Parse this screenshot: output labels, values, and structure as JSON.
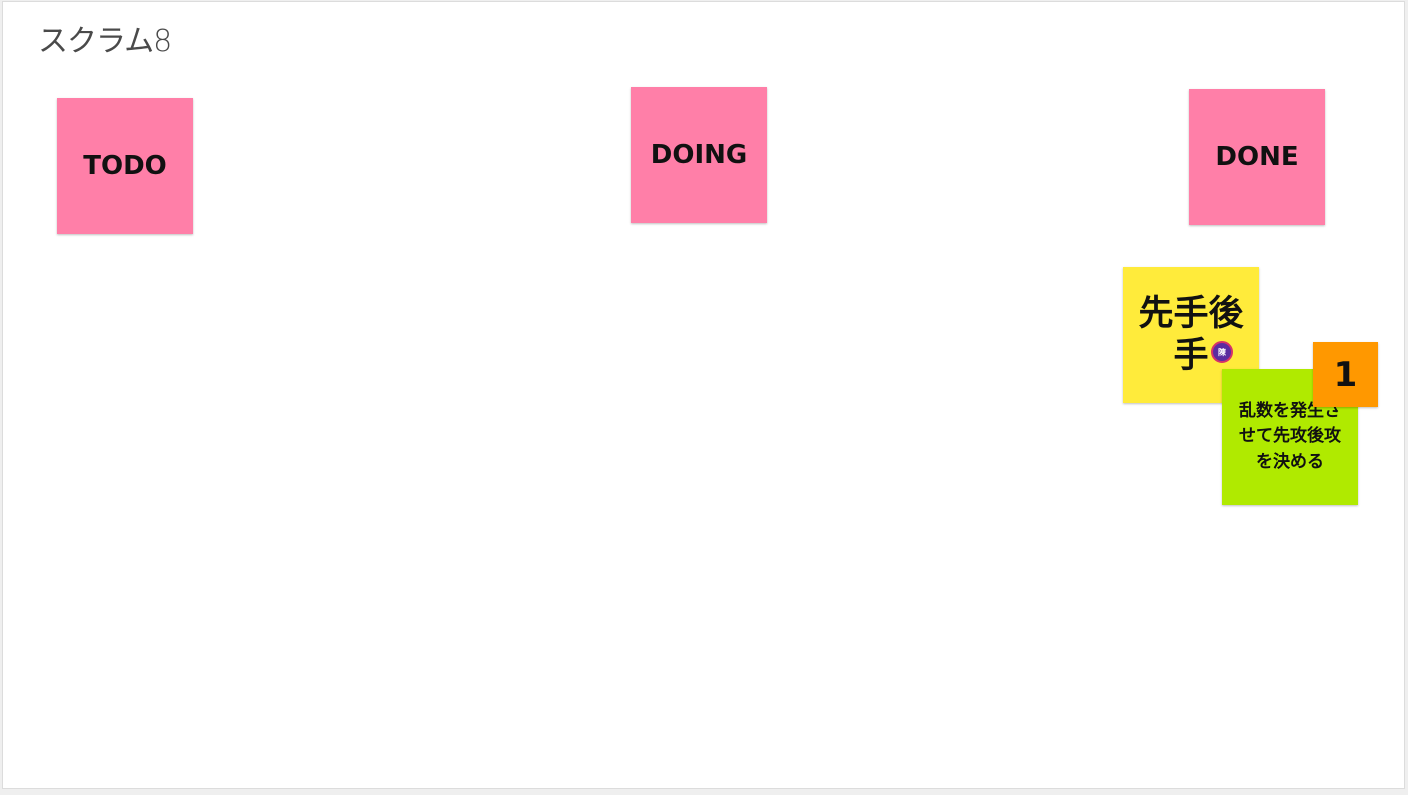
{
  "board": {
    "title": "スクラム8"
  },
  "columns": [
    {
      "label": "TODO"
    },
    {
      "label": "DOING"
    },
    {
      "label": "DONE"
    }
  ],
  "notes": {
    "first_second": {
      "text": "先手後手"
    },
    "random_task": {
      "text": "乱数を発生させて先攻後攻を決める"
    },
    "count": {
      "text": "1"
    }
  },
  "cursor": {
    "initial": "陳"
  },
  "colors": {
    "pink": "#ff7fa8",
    "yellow": "#ffeb3b",
    "green": "#b0ea00",
    "orange": "#ff9800",
    "avatar": "#5b2ca0"
  }
}
